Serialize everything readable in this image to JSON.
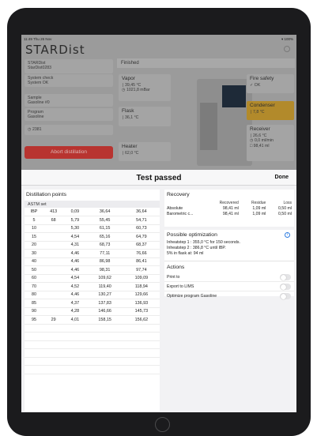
{
  "status_bar": {
    "time": "11:49  Thu 26 Nov",
    "battery": "▾ 100%"
  },
  "app": {
    "logo": "STARDist"
  },
  "left_panel": {
    "device_title": "STARDist",
    "device_name": "StarDist0283",
    "system_check_label": "System check",
    "system_check_value": "System OK",
    "sample_label": "Sample",
    "sample_value": "Gasoline #0",
    "program_label": "Program",
    "program_value": "Gasoline",
    "timer": "2381",
    "abort_label": "Abort distillation"
  },
  "background_status": {
    "finished": "Finished",
    "vapor_title": "Vapor",
    "vapor_temp": "39,45 °C",
    "vapor_pressure": "1021,8 mBar",
    "flask_title": "Flask",
    "flask_temp": "36,1 °C",
    "heater_title": "Heater",
    "heater_temp": "62,0 °C",
    "fire_title": "Fire safety",
    "fire_value": "OK",
    "condenser_title": "Condenser",
    "condenser_temp": "7,8 °C",
    "receiver_title": "Receiver",
    "receiver_temp": "26,6 °C",
    "receiver_flow": "0,0 ml/min",
    "receiver_vol": "98,41 ml"
  },
  "sheet": {
    "title": "Test passed",
    "done": "Done"
  },
  "distillation": {
    "title": "Distillation points",
    "set_label": "ASTM set",
    "rows": [
      [
        "IBP",
        "413",
        "0,09",
        "36,64",
        "36,64"
      ],
      [
        "5",
        "68",
        "5,79",
        "55,45",
        "54,71"
      ],
      [
        "10",
        "",
        "5,30",
        "61,15",
        "60,73"
      ],
      [
        "15",
        "",
        "4,54",
        "65,16",
        "64,79"
      ],
      [
        "20",
        "",
        "4,31",
        "68,73",
        "68,37"
      ],
      [
        "30",
        "",
        "4,46",
        "77,11",
        "76,66"
      ],
      [
        "40",
        "",
        "4,46",
        "86,98",
        "86,41"
      ],
      [
        "50",
        "",
        "4,46",
        "98,31",
        "97,74"
      ],
      [
        "60",
        "",
        "4,54",
        "109,62",
        "109,09"
      ],
      [
        "70",
        "",
        "4,52",
        "119,40",
        "118,94"
      ],
      [
        "80",
        "",
        "4,46",
        "130,27",
        "129,66"
      ],
      [
        "85",
        "",
        "4,37",
        "137,83",
        "136,93"
      ],
      [
        "90",
        "",
        "4,28",
        "146,66",
        "145,73"
      ],
      [
        "95",
        "29",
        "4,01",
        "158,15",
        "156,62"
      ],
      [
        "",
        "",
        "",
        "",
        ""
      ],
      [
        "",
        "",
        "",
        "",
        ""
      ],
      [
        "",
        "",
        "",
        "",
        ""
      ],
      [
        "",
        "",
        "",
        "",
        ""
      ],
      [
        "",
        "",
        "",
        "",
        ""
      ],
      [
        "",
        "",
        "",
        "",
        ""
      ]
    ]
  },
  "recovery": {
    "title": "Recovery",
    "headers": [
      "Recovered",
      "Residue",
      "Loss"
    ],
    "rows": [
      [
        "Absolute",
        "98,41 ml",
        "1,09 ml",
        "0,50 ml"
      ],
      [
        "Barometric c...",
        "98,41 ml",
        "1,09 ml",
        "0,50 ml"
      ]
    ]
  },
  "optimization": {
    "title": "Possible optimization",
    "lines": [
      "Inheatstep 1 :  355,0 °C for 150 seconds.",
      "Inheatstep 2 :  386,8 °C until IBP.",
      "5% in flask at:  94 ml"
    ]
  },
  "actions": {
    "title": "Actions",
    "items": [
      "Print to",
      "Export to LIMS",
      "Optimize program Gasoline"
    ]
  }
}
